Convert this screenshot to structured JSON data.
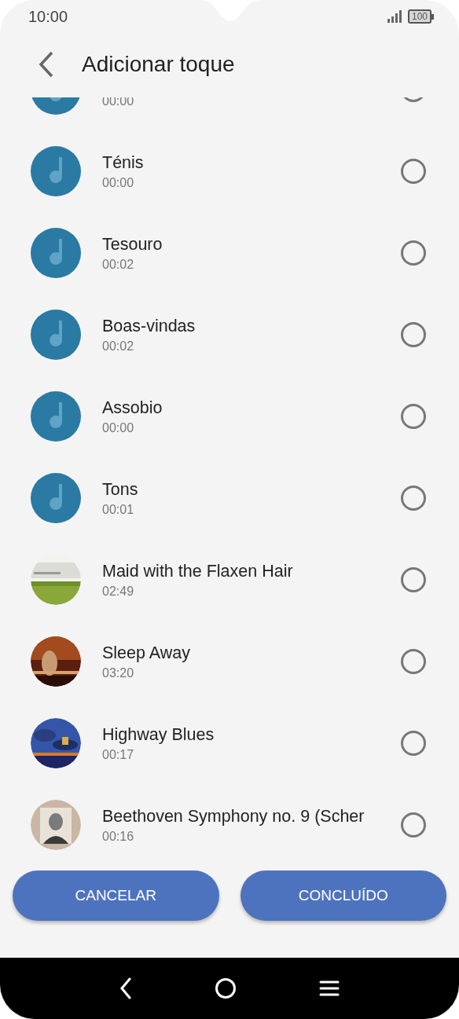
{
  "status_bar": {
    "time": "10:00",
    "battery": "100"
  },
  "header": {
    "title": "Adicionar toque"
  },
  "ringtones": [
    {
      "kind": "tone",
      "duration": "00:00",
      "selected": false
    },
    {
      "kind": "tone",
      "title": "Ténis",
      "duration": "00:00",
      "selected": false
    },
    {
      "kind": "tone",
      "title": "Tesouro",
      "duration": "00:02",
      "selected": false
    },
    {
      "kind": "tone",
      "title": "Boas-vindas",
      "duration": "00:02",
      "selected": false
    },
    {
      "kind": "tone",
      "title": "Assobio",
      "duration": "00:00",
      "selected": false
    },
    {
      "kind": "tone",
      "title": "Tons",
      "duration": "00:01",
      "selected": false
    },
    {
      "kind": "picture",
      "title": "Maid with the Flaxen Hair",
      "duration": "02:49",
      "selected": false
    },
    {
      "kind": "picture",
      "title": "Sleep Away",
      "duration": "03:20",
      "selected": false
    },
    {
      "kind": "picture",
      "title": "Highway Blues",
      "duration": "00:17",
      "selected": false
    },
    {
      "kind": "picture",
      "title": "Beethoven Symphony no. 9 (Scher",
      "duration": "00:16",
      "selected": false
    }
  ],
  "buttons": [
    {
      "label": "CANCELAR"
    },
    {
      "label": "CONCLUÍDO"
    }
  ]
}
